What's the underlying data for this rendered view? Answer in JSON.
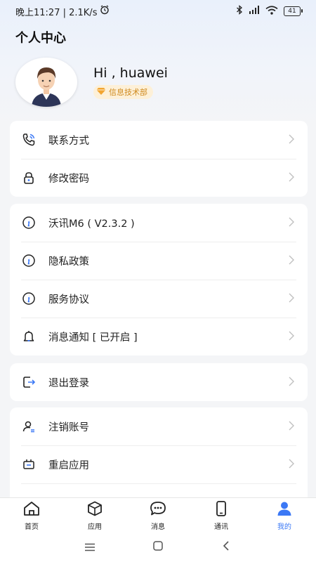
{
  "status_bar": {
    "time_speed": "晚上11:27 | 2.1K/s",
    "battery": "41"
  },
  "header": {
    "title": "个人中心"
  },
  "profile": {
    "greeting": "Hi , huawei",
    "department": "信息技术部"
  },
  "groups": [
    {
      "items": [
        {
          "label": "联系方式",
          "icon": "phone-icon"
        },
        {
          "label": "修改密码",
          "icon": "lock-icon"
        }
      ]
    },
    {
      "items": [
        {
          "label": "沃讯M6 ( V2.3.2 )",
          "icon": "info-icon"
        },
        {
          "label": "隐私政策",
          "icon": "info-icon"
        },
        {
          "label": "服务协议",
          "icon": "info-icon"
        },
        {
          "label": "消息通知 [ 已开启 ]",
          "icon": "bell-icon"
        }
      ]
    },
    {
      "items": [
        {
          "label": "退出登录",
          "icon": "logout-icon"
        }
      ]
    },
    {
      "items": [
        {
          "label": "注销账号",
          "icon": "user-cancel-icon"
        },
        {
          "label": "重启应用",
          "icon": "restart-icon"
        }
      ]
    }
  ],
  "tabs": [
    {
      "label": "首页",
      "icon": "home-icon"
    },
    {
      "label": "应用",
      "icon": "cube-icon"
    },
    {
      "label": "消息",
      "icon": "chat-icon"
    },
    {
      "label": "通讯",
      "icon": "phone-device-icon"
    },
    {
      "label": "我的",
      "icon": "user-icon",
      "active": true
    }
  ],
  "colors": {
    "accent": "#3b78f5",
    "badge_bg": "#fdf0d8",
    "badge_text": "#d08a1e"
  }
}
